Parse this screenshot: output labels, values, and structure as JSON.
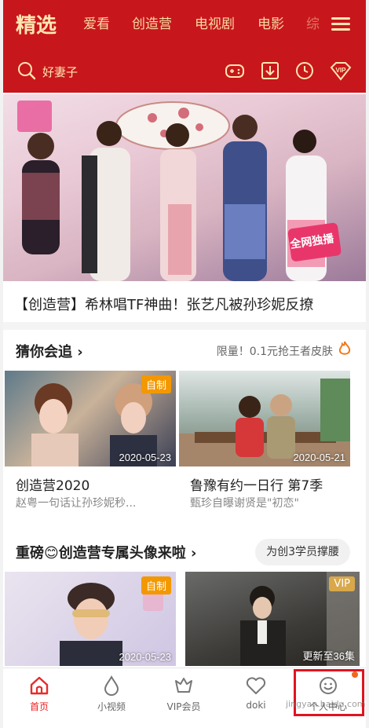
{
  "header": {
    "tabs": [
      "精选",
      "爱看",
      "创造营",
      "电视剧",
      "电影",
      "综"
    ],
    "search_placeholder": "好妻子",
    "icons": [
      "game-icon",
      "download-icon",
      "history-icon",
      "vip-icon"
    ],
    "brand_color": "#c8161d",
    "text_color": "#ffe6b0"
  },
  "banner": {
    "caption": "【创造营】希林唱TF神曲！张艺凡被孙珍妮反撩",
    "badge": "全网独播"
  },
  "section1": {
    "title": "猜你会追 ›",
    "right_text": "限量！0.1元抢王者皮肤",
    "cards": [
      {
        "title": "创造营2020",
        "subtitle": "赵粤一句话让孙珍妮秒...",
        "date": "2020-05-23",
        "tag": "自制"
      },
      {
        "title": "鲁豫有约一日行 第7季",
        "subtitle": "甄珍自曝谢贤是\"初恋\"",
        "date": "2020-05-21",
        "tag": ""
      }
    ]
  },
  "section2": {
    "title": "重磅😊创造营专属头像来啦 ›",
    "pill": "为创3学员撑腰",
    "cards": [
      {
        "date": "2020-05-23",
        "tag": "自制"
      },
      {
        "date": "更新至36集",
        "tag": "VIP"
      }
    ]
  },
  "bottom_nav": {
    "items": [
      {
        "label": "首页",
        "icon": "home-icon"
      },
      {
        "label": "小视频",
        "icon": "droplet-icon"
      },
      {
        "label": "VIP会员",
        "icon": "crown-icon"
      },
      {
        "label": "doki",
        "icon": "heart-icon"
      },
      {
        "label": "个人中心",
        "icon": "smiley-icon"
      }
    ],
    "active_color": "#e62b2b"
  },
  "watermark": "jingyan.baidu.com"
}
